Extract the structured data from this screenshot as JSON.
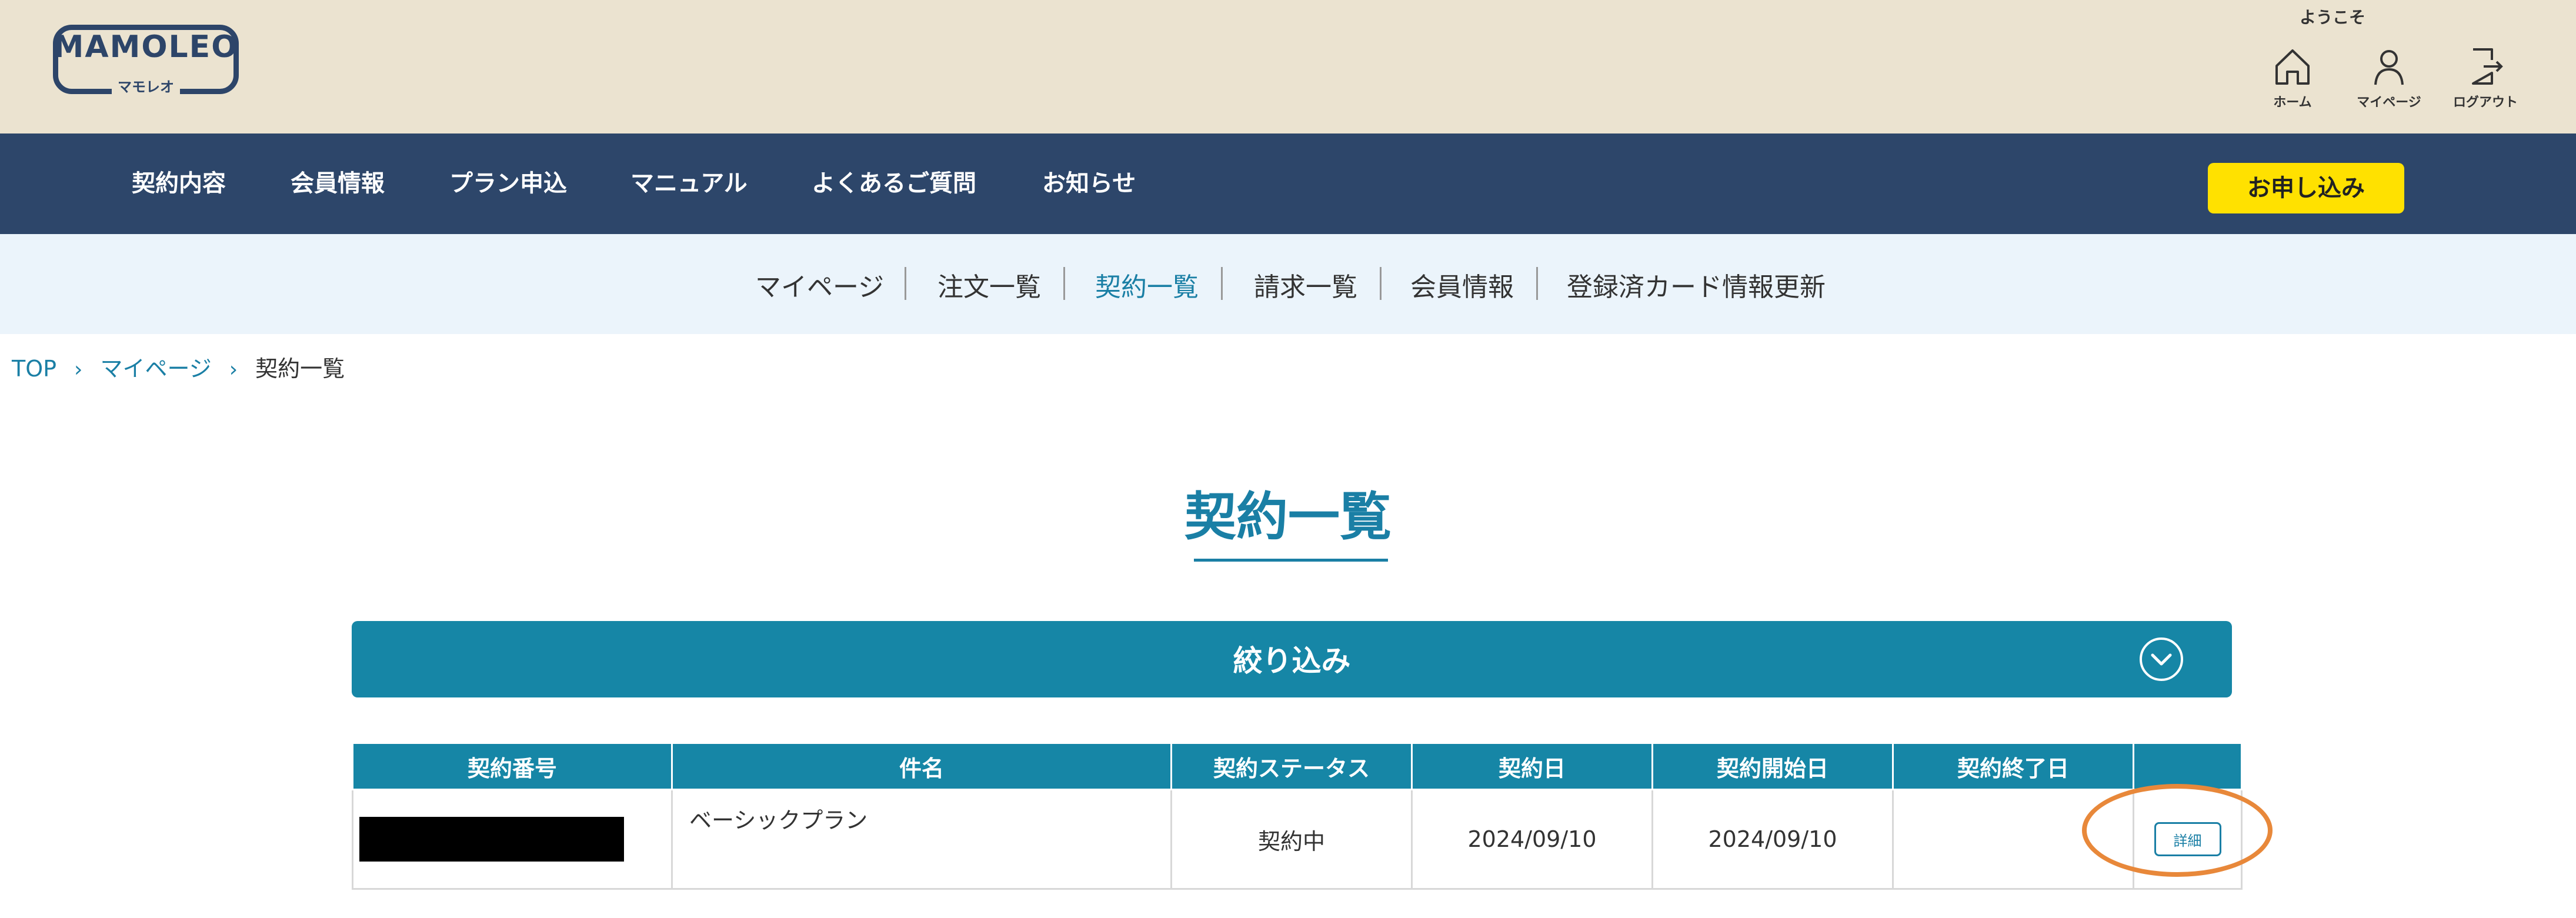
{
  "header": {
    "logo_text": "MAMOLEO",
    "logo_sub": "マモレオ",
    "welcome": "ようこそ",
    "icons": [
      {
        "name": "home-icon",
        "label": "ホーム"
      },
      {
        "name": "user-icon",
        "label": "マイページ"
      },
      {
        "name": "logout-icon",
        "label": "ログアウト"
      }
    ]
  },
  "nav": {
    "items": [
      "契約内容",
      "会員情報",
      "プラン申込",
      "マニュアル",
      "よくあるご質問",
      "お知らせ"
    ],
    "apply_label": "お申し込み"
  },
  "subnav": {
    "items": [
      "マイページ",
      "注文一覧",
      "契約一覧",
      "請求一覧",
      "会員情報",
      "登録済カード情報更新"
    ],
    "active": "契約一覧"
  },
  "breadcrumb": {
    "items": [
      "TOP",
      "マイページ",
      "契約一覧"
    ]
  },
  "page": {
    "title": "契約一覧"
  },
  "filter": {
    "label": "絞り込み"
  },
  "table": {
    "headers": [
      "契約番号",
      "件名",
      "契約ステータス",
      "契約日",
      "契約開始日",
      "契約終了日",
      ""
    ],
    "rows": [
      {
        "contract_no": "",
        "name": "ベーシックプラン",
        "status": "契約中",
        "contract_date": "2024/09/10",
        "start_date": "2024/09/10",
        "end_date": "",
        "detail_label": "詳細"
      }
    ]
  },
  "colors": {
    "header_bg": "#ebe3d0",
    "nav_bg": "#2d466a",
    "subnav_bg": "#ebf4fb",
    "accent": "#1686a6",
    "apply_button": "#ffe100",
    "highlight_ring": "#e8883a"
  }
}
